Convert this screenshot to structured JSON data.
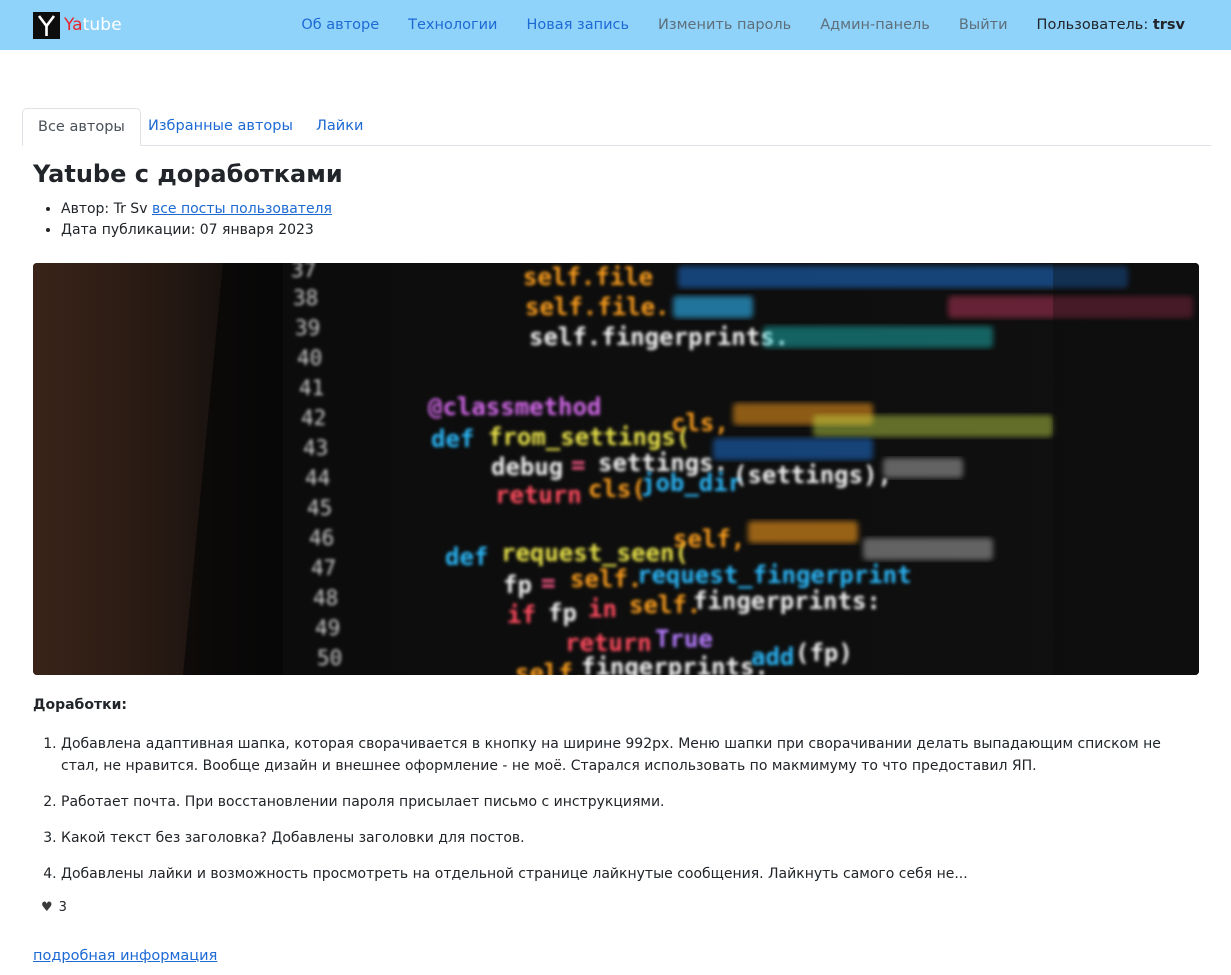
{
  "header": {
    "brand": {
      "logo_letter": "Y",
      "ya": "Ya",
      "tube": "tube"
    },
    "nav": [
      {
        "label": "Об авторе",
        "style": "primary"
      },
      {
        "label": "Технологии",
        "style": "primary"
      },
      {
        "label": "Новая запись",
        "style": "primary"
      },
      {
        "label": "Изменить пароль",
        "style": "muted"
      },
      {
        "label": "Админ-панель",
        "style": "muted"
      },
      {
        "label": "Выйти",
        "style": "muted"
      }
    ],
    "user_prefix": "Пользователь:",
    "username": "trsv"
  },
  "tabs": [
    {
      "label": "Все авторы",
      "active": true
    },
    {
      "label": "Избранные авторы",
      "active": false
    },
    {
      "label": "Лайки",
      "active": false
    }
  ],
  "post": {
    "title": "Yatube с доработками",
    "author_prefix": "Автор: Tr Sv",
    "author_link": "все посты пользователя",
    "date_prefix": "Дата публикации:",
    "date": "07 января 2023",
    "image": {
      "line_numbers": [
        "37",
        "38",
        "39",
        "40",
        "41",
        "42",
        "43",
        "44",
        "45",
        "46",
        "47",
        "48",
        "49",
        "50"
      ],
      "code": {
        "l1": "self.file",
        "l2": "self.file.",
        "l3": "self.fingerprints.",
        "decorator": "@classmethod",
        "def1_kw": "def",
        "def1_name": "from_settings(",
        "def1_cls": "cls,",
        "debug": "debug",
        "eq": "=",
        "settings": "settings.",
        "return_kw": "return",
        "cls": "cls(",
        "job_dir": "job_dir",
        "job_args": "(settings),",
        "def2_kw": "def",
        "def2_name": "request_seen(",
        "def2_self": "self,",
        "fp": "fp",
        "self_req": "self.",
        "req_fp": "request_fingerprint",
        "if_kw": "if",
        "in_kw": "in",
        "self_fp": "self.",
        "fingerprints": "fingerprints:",
        "return2": "return",
        "true": "True",
        "last_self": "self.",
        "last_fp": "fingerprints.",
        "add": "add",
        "add_args": "(fp)"
      }
    },
    "section_title": "Доработки:",
    "items": [
      "Добавлена адаптивная шапка, которая сворачивается в кнопку на ширине 992px. Меню шапки при сворачивании делать выпадающим списком не стал, не нравится. Вообще дизайн и внешнее оформление - не моё. Старался использовать по макмимуму то что предоставил ЯП.",
      "Работает почта. При восстановлении пароля присылает письмо с инструкциями.",
      "Какой текст без заголовка? Добавлены заголовки для постов.",
      "Добавлены лайки и возможность просмотреть на отдельной странице лайкнутые сообщения. Лайкнуть самого себя не..."
    ],
    "likes_count": "3",
    "more_link": "подробная информация"
  },
  "colors": {
    "navbar": "#8fd3fb",
    "link": "#1d6ad4",
    "ya_red": "#e8262d"
  }
}
